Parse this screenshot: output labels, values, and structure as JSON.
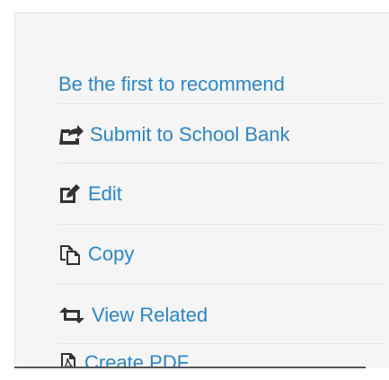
{
  "actions": {
    "recommend_label": "Be the first to recommend",
    "submit_label": "Submit to School Bank",
    "edit_label": "Edit",
    "copy_label": "Copy",
    "view_related_label": "View Related",
    "create_pdf_label": "Create PDF"
  },
  "icons": {
    "submit": "share-icon",
    "edit": "edit-icon",
    "copy": "copy-icon",
    "view_related": "retweet-icon",
    "create_pdf": "pdf-file-icon"
  },
  "colors": {
    "link": "#2a86c9",
    "icon": "#333333",
    "panel_background": "#f5f5f5",
    "separator": "#e4e4e4"
  }
}
